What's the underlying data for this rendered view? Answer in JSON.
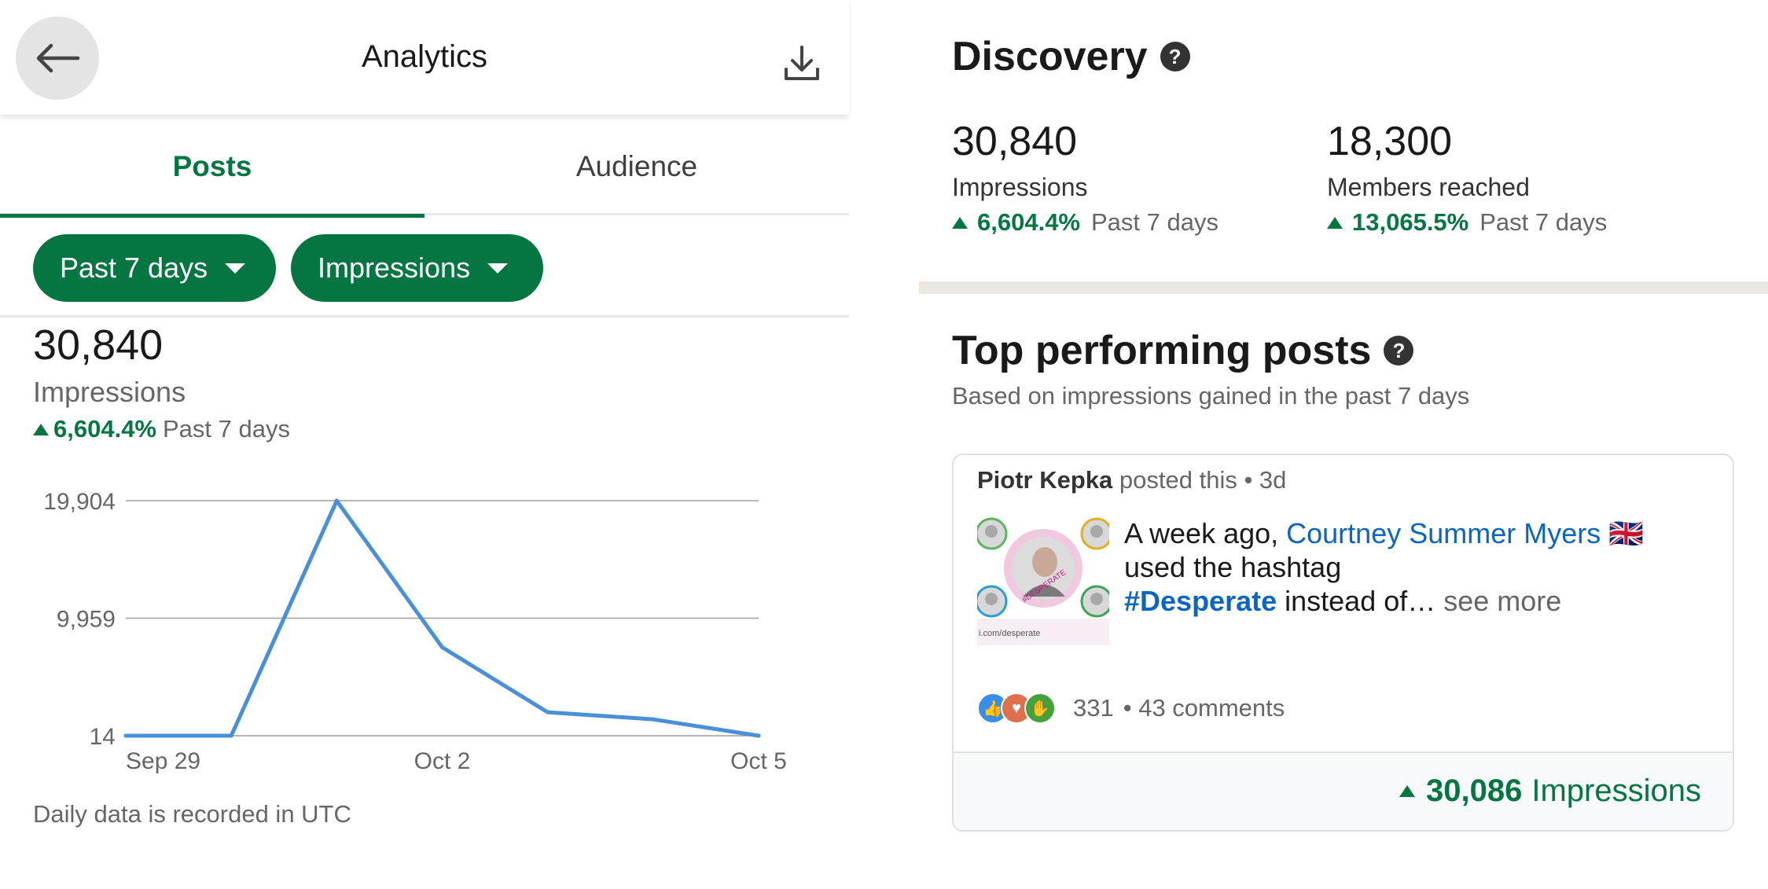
{
  "header": {
    "title": "Analytics"
  },
  "tabs": [
    {
      "label": "Posts"
    },
    {
      "label": "Audience"
    }
  ],
  "filters": {
    "period": "Past 7 days",
    "metric": "Impressions"
  },
  "summary": {
    "value": "30,840",
    "label": "Impressions",
    "delta": "6,604.4%",
    "period": "Past 7 days"
  },
  "chart_data": {
    "type": "line",
    "x": [
      "Sep 29",
      "Sep 30",
      "Oct 1",
      "Oct 2",
      "Oct 3",
      "Oct 4",
      "Oct 5"
    ],
    "values": [
      14,
      14,
      19904,
      7500,
      2000,
      1400,
      14
    ],
    "yticks": [
      "19,904",
      "9,959",
      "14"
    ],
    "ytick_values": [
      19904,
      9959,
      14
    ],
    "xtick_labels": [
      "Sep 29",
      "Oct 2",
      "Oct 5"
    ],
    "ylim": [
      14,
      19904
    ],
    "grid": true,
    "color": "#4a90d9"
  },
  "footnote": "Daily data is recorded in UTC",
  "discovery": {
    "title": "Discovery",
    "metrics": [
      {
        "value": "30,840",
        "label": "Impressions",
        "delta": "6,604.4%",
        "period": "Past 7 days"
      },
      {
        "value": "18,300",
        "label": "Members reached",
        "delta": "13,065.5%",
        "period": "Past 7 days"
      }
    ]
  },
  "top_posts": {
    "title": "Top performing posts",
    "subtitle": "Based on impressions gained in the past 7 days",
    "post": {
      "author": "Piotr Kepka",
      "meta": "posted this • 3d",
      "text_prefix": "A week ago, ",
      "mention": "Courtney Summer Myers 🇬🇧",
      "text_mid": "used the hashtag",
      "hashtag": "#Desperate",
      "text_suffix": " instead of… ",
      "see_more": "see more",
      "thumb_caption": "i.com/desperate",
      "thumb_badge": "#DESPERATE",
      "reactions": "331",
      "comments": "• 43 comments",
      "impressions": "30,086",
      "impressions_label": "Impressions"
    }
  },
  "colors": {
    "brand_green": "#057642",
    "link_blue": "#0a66c2",
    "chart_line": "#4a90d9"
  }
}
